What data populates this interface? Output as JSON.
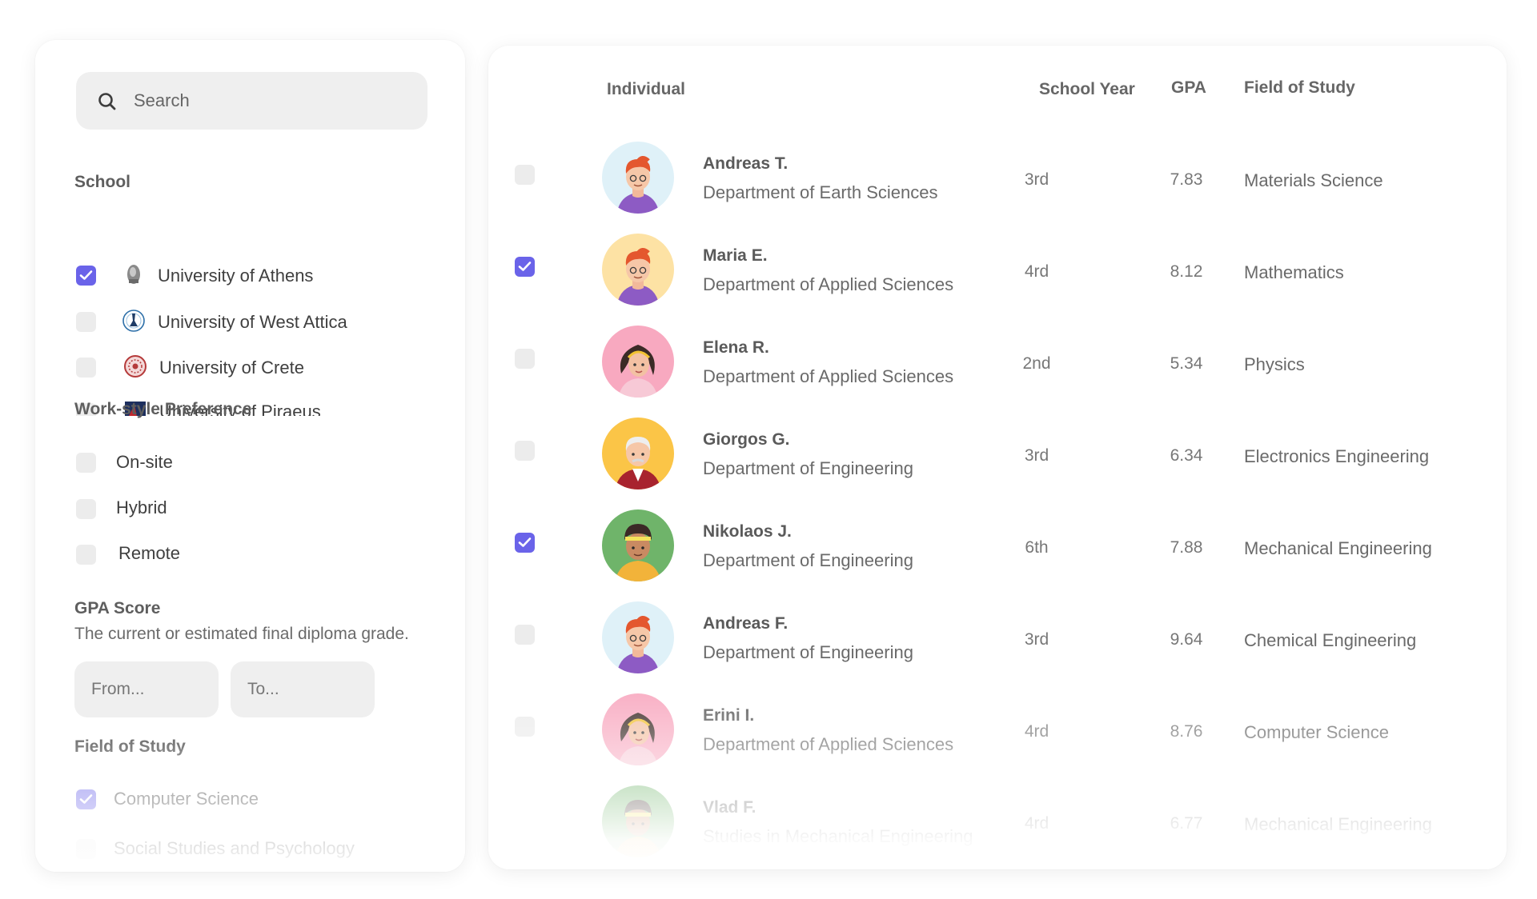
{
  "search": {
    "placeholder": "Search"
  },
  "filters": {
    "school": {
      "title": "School",
      "items": [
        {
          "label": "University of Athens",
          "checked": true,
          "logo": "athens-logo-icon"
        },
        {
          "label": "University of West Attica",
          "checked": false,
          "logo": "west-attica-logo-icon"
        },
        {
          "label": "University of Crete",
          "checked": false,
          "logo": "crete-logo-icon"
        },
        {
          "label": "University of Piraeus",
          "checked": false,
          "logo": "piraeus-logo-icon"
        }
      ]
    },
    "work_style": {
      "title": "Work-style Preference",
      "items": [
        {
          "label": "On-site",
          "checked": false
        },
        {
          "label": "Hybrid",
          "checked": false
        },
        {
          "label": "Remote",
          "checked": false
        }
      ]
    },
    "gpa": {
      "title": "GPA Score",
      "description": "The current or estimated final diploma grade.",
      "from_placeholder": "From...",
      "to_placeholder": "To..."
    },
    "field_of_study": {
      "title": "Field of Study",
      "items": [
        {
          "label": "Computer Science",
          "checked": true
        },
        {
          "label": "Social Studies and Psychology",
          "checked": false
        }
      ]
    }
  },
  "table": {
    "columns": {
      "individual": "Individual",
      "school_year": "School Year",
      "gpa": "GPA",
      "field": "Field of Study"
    },
    "rows": [
      {
        "name": "Andreas T.",
        "department": "Department of Earth Sciences",
        "year": "3rd",
        "gpa": "7.83",
        "field": "Materials Science",
        "checked": false,
        "avatar": "avatar-redhead-man"
      },
      {
        "name": "Maria E.",
        "department": "Department of Applied Sciences",
        "year": "4rd",
        "gpa": "8.12",
        "field": "Mathematics",
        "checked": true,
        "avatar": "avatar-redhead-man"
      },
      {
        "name": "Elena R.",
        "department": "Department of Applied Sciences",
        "year": "2nd",
        "gpa": "5.34",
        "field": "Physics",
        "checked": false,
        "avatar": "avatar-woman"
      },
      {
        "name": "Giorgos G.",
        "department": "Department of Engineering",
        "year": "3rd",
        "gpa": "6.34",
        "field": "Electronics Engineering",
        "checked": false,
        "avatar": "avatar-old-man"
      },
      {
        "name": "Nikolaos J.",
        "department": "Department of Engineering",
        "year": "6th",
        "gpa": "7.88",
        "field": "Mechanical Engineering",
        "checked": true,
        "avatar": "avatar-headband-man"
      },
      {
        "name": "Andreas F.",
        "department": "Department of Engineering",
        "year": "3rd",
        "gpa": "9.64",
        "field": "Chemical Engineering",
        "checked": false,
        "avatar": "avatar-redhead-man"
      },
      {
        "name": "Erini I.",
        "department": "Department of Applied Sciences",
        "year": "4rd",
        "gpa": "8.76",
        "field": "Computer Science",
        "checked": false,
        "avatar": "avatar-woman"
      },
      {
        "name": "Vlad F.",
        "department": "Studies in Mechanical Engineering",
        "year": "4rd",
        "gpa": "6.77",
        "field": "Mechanical Engineering",
        "checked": false,
        "avatar": "avatar-headband-man"
      }
    ]
  },
  "colors": {
    "accent": "#6a63e9",
    "checkbox_off": "#ececec",
    "avatar_bg_blue": "#dff1f8",
    "avatar_bg_yellow": "#fde2a4",
    "avatar_bg_pink": "#f8a9c0",
    "avatar_bg_orange": "#fbc547",
    "avatar_bg_green": "#6fb46a"
  }
}
